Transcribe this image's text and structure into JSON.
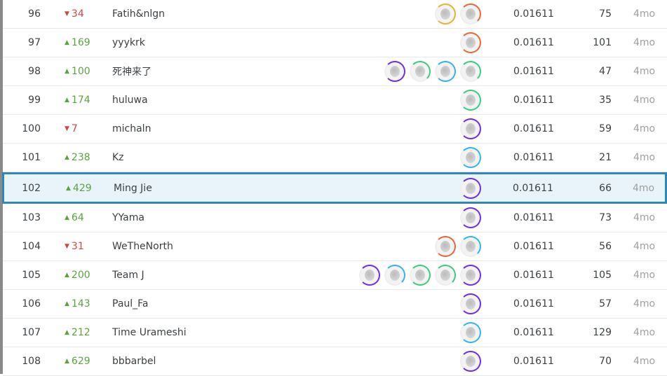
{
  "tier_colors": {
    "gold": "#e0b531",
    "orange": "#e8673c",
    "purple": "#6f2fe0",
    "blue": "#35b3f0",
    "green": "#3dcb7f"
  },
  "rows": [
    {
      "rank": "96",
      "dir": "down",
      "change": "34",
      "name": "Fatih&nlgn",
      "avatars": [
        "gold",
        "orange"
      ],
      "score": "0.01611",
      "entries": "75",
      "last": "4mo"
    },
    {
      "rank": "97",
      "dir": "up",
      "change": "169",
      "name": "yyykrk",
      "avatars": [
        "orange"
      ],
      "score": "0.01611",
      "entries": "101",
      "last": "4mo"
    },
    {
      "rank": "98",
      "dir": "up",
      "change": "100",
      "name": "死神来了",
      "avatars": [
        "purple",
        "green",
        "blue",
        "green"
      ],
      "score": "0.01611",
      "entries": "47",
      "last": "4mo"
    },
    {
      "rank": "99",
      "dir": "up",
      "change": "174",
      "name": "huluwa",
      "avatars": [
        "green"
      ],
      "score": "0.01611",
      "entries": "35",
      "last": "4mo"
    },
    {
      "rank": "100",
      "dir": "down",
      "change": "7",
      "name": "michaln",
      "avatars": [
        "purple"
      ],
      "score": "0.01611",
      "entries": "59",
      "last": "4mo"
    },
    {
      "rank": "101",
      "dir": "up",
      "change": "238",
      "name": "Kz",
      "avatars": [
        "blue"
      ],
      "score": "0.01611",
      "entries": "21",
      "last": "4mo"
    },
    {
      "rank": "102",
      "dir": "up",
      "change": "429",
      "name": "Ming Jie",
      "avatars": [
        "purple"
      ],
      "score": "0.01611",
      "entries": "66",
      "last": "4mo",
      "highlighted": true
    },
    {
      "rank": "103",
      "dir": "up",
      "change": "64",
      "name": "YYama",
      "avatars": [
        "purple"
      ],
      "score": "0.01611",
      "entries": "73",
      "last": "4mo"
    },
    {
      "rank": "104",
      "dir": "down",
      "change": "31",
      "name": "WeTheNorth",
      "avatars": [
        "orange",
        "blue"
      ],
      "score": "0.01611",
      "entries": "56",
      "last": "4mo"
    },
    {
      "rank": "105",
      "dir": "up",
      "change": "200",
      "name": "Team J",
      "avatars": [
        "purple",
        "blue",
        "green",
        "green",
        "purple"
      ],
      "score": "0.01611",
      "entries": "105",
      "last": "4mo"
    },
    {
      "rank": "106",
      "dir": "up",
      "change": "143",
      "name": "Paul_Fa",
      "avatars": [
        "purple"
      ],
      "score": "0.01611",
      "entries": "57",
      "last": "4mo"
    },
    {
      "rank": "107",
      "dir": "up",
      "change": "212",
      "name": "Time Urameshi",
      "avatars": [
        "blue"
      ],
      "score": "0.01611",
      "entries": "129",
      "last": "4mo"
    },
    {
      "rank": "108",
      "dir": "up",
      "change": "629",
      "name": "bbbarbel",
      "avatars": [
        "purple"
      ],
      "score": "0.01611",
      "entries": "70",
      "last": "4mo"
    }
  ]
}
